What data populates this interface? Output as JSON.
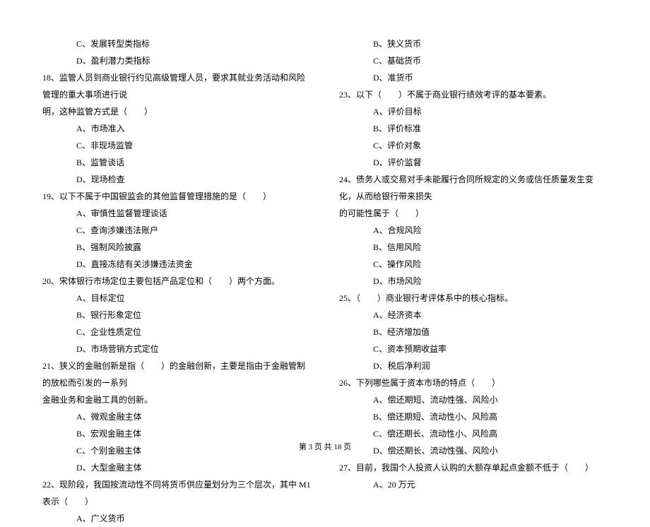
{
  "left": {
    "opt_c_before_q18": "C、发展转型类指标",
    "opt_d_before_q18": "D、盈利潜力类指标",
    "q18": "18、监管人员到商业银行约见高级管理人员，要求其就业务活动和风险管理的重大事项进行说",
    "q18_line2": "明，这种监管方式是（　　）",
    "q18a": "A、市场准入",
    "q18c": "C、非现场监管",
    "q18b": "B、监管谈话",
    "q18d": "D、现场检查",
    "q19": "19、以下不属于中国银监会的其他监督管理措施的是（　　）",
    "q19a": "A、审慎性监督管理谈话",
    "q19c": "C、查询涉嫌违法账户",
    "q19b": "B、强制风险披露",
    "q19d": "D、直接冻结有关涉嫌违法资金",
    "q20": "20、宋体银行市场定位主要包括产品定位和（　　）两个方面。",
    "q20a": "A、目标定位",
    "q20b": "B、银行形象定位",
    "q20c": "C、企业性质定位",
    "q20d": "D、市场营销方式定位",
    "q21": "21、狭义的金融创新是指（　　）的金融创新，主要是指由于金融管制的放松而引发的一系列",
    "q21_line2": "金融业务和金融工具的创新。",
    "q21a": "A、微观金融主体",
    "q21b": "B、宏观金融主体",
    "q21c": "C、个别金融主体",
    "q21d": "D、大型金融主体",
    "q22": "22、现阶段，我国按流动性不同将货币供应量划分为三个层次，其中 M1 表示（　　）",
    "q22a": "A、广义货币"
  },
  "right": {
    "opt_b_before_q23": "B、狭义货币",
    "opt_c_before_q23": "C、基础货币",
    "opt_d_before_q23": "D、准货币",
    "q23": "23、以下（　　）不属于商业银行绩效考评的基本要素。",
    "q23a": "A、评价目标",
    "q23b": "B、评价标准",
    "q23c": "C、评价对象",
    "q23d": "D、评价监督",
    "q24": "24、债务人或交易对手未能履行合同所规定的义务或信任质量发生变化，从而给银行带来损失",
    "q24_line2": "的可能性属于（　　）",
    "q24a": "A、合规风险",
    "q24b": "B、信用风险",
    "q24c": "C、操作风险",
    "q24d": "D、市场风险",
    "q25": "25、（　　）商业银行考评体系中的核心指标。",
    "q25a": "A、经济资本",
    "q25b": "B、经济增加值",
    "q25c": "C、资本预期收益率",
    "q25d": "D、税后净利润",
    "q26": "26、下列哪些属于资本市场的特点（　　）",
    "q26a": "A、偿还期短、流动性强、风险小",
    "q26b": "B、偿还期短、流动性小、风险高",
    "q26c": "C、偿还期长、流动性小、风险高",
    "q26d": "D、偿还期长、流动性强、风险小",
    "q27": "27、目前，我国个人投资人认购的大额存单起点金额不低于（　　）",
    "q27a": "A、20 万元"
  },
  "footer": "第 3 页 共 18 页"
}
